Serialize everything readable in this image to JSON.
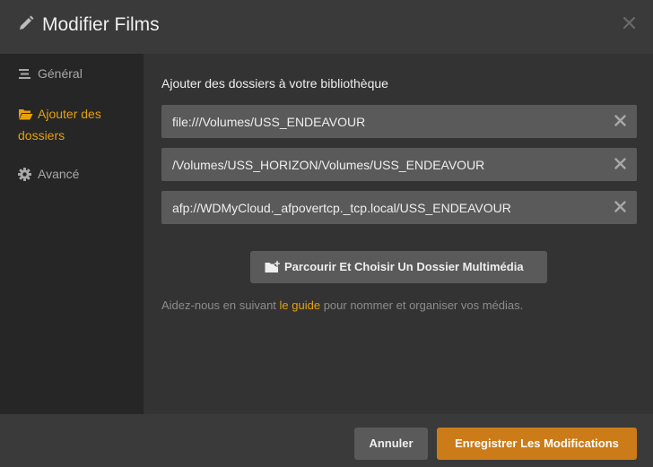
{
  "header": {
    "title": "Modifier Films"
  },
  "sidebar": {
    "items": [
      {
        "label": "Général",
        "icon": "list-icon"
      },
      {
        "label": "Ajouter des dossiers",
        "icon": "folder-open-icon",
        "active": true
      },
      {
        "label": "Avancé",
        "icon": "gear-icon"
      }
    ]
  },
  "main": {
    "section_title": "Ajouter des dossiers à votre bibliothèque",
    "folders": [
      "file:///Volumes/USS_ENDEAVOUR",
      "/Volumes/USS_HORIZON/Volumes/USS_ENDEAVOUR",
      "afp://WDMyCloud._afpovertcp._tcp.local/USS_ENDEAVOUR"
    ],
    "browse_label": "Parcourir Et Choisir Un Dossier Multimédia",
    "help_prefix": "Aidez-nous en suivant ",
    "help_link": "le guide",
    "help_suffix": " pour nommer et organiser vos médias."
  },
  "footer": {
    "cancel_label": "Annuler",
    "save_label": "Enregistrer Les Modifications"
  },
  "colors": {
    "accent": "#e5a00d",
    "save_button": "#cc7b19",
    "sidebar_bg": "#262626",
    "main_bg": "#333333",
    "field_bg": "#5a5a5a"
  }
}
